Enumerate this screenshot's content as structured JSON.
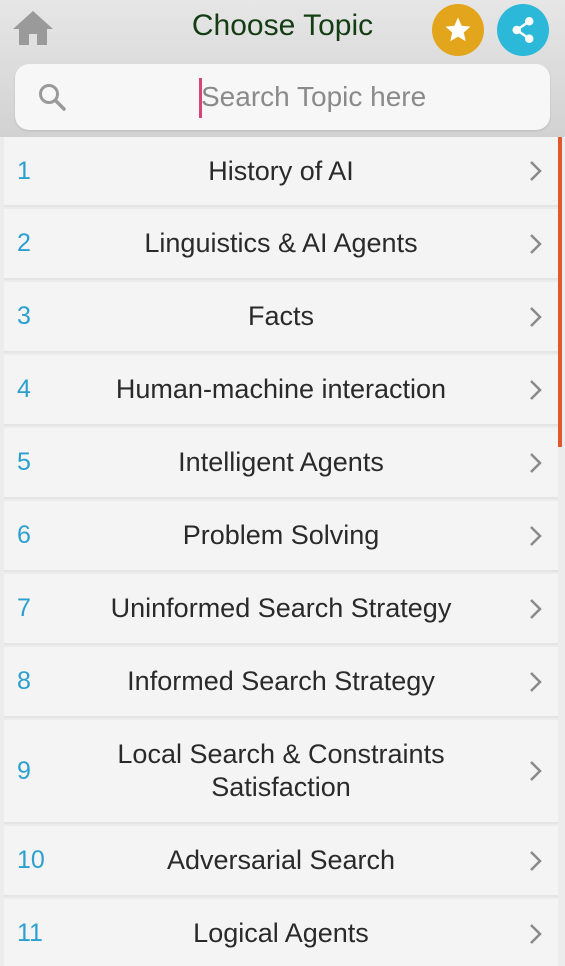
{
  "header": {
    "title": "Choose Topic",
    "home_icon": "home-icon",
    "favorite_icon": "star-icon",
    "share_icon": "share-icon",
    "favorite_color": "#e3a51b",
    "share_color": "#2cb8d8"
  },
  "search": {
    "placeholder": "Search Topic here",
    "value": ""
  },
  "topics": [
    {
      "number": "1",
      "label": "History of AI"
    },
    {
      "number": "2",
      "label": "Linguistics & AI Agents"
    },
    {
      "number": "3",
      "label": "Facts"
    },
    {
      "number": "4",
      "label": "Human-machine interaction"
    },
    {
      "number": "5",
      "label": "Intelligent Agents"
    },
    {
      "number": "6",
      "label": "Problem Solving"
    },
    {
      "number": "7",
      "label": "Uninformed Search Strategy"
    },
    {
      "number": "8",
      "label": "Informed Search Strategy"
    },
    {
      "number": "9",
      "label": "Local Search & Constraints Satisfaction"
    },
    {
      "number": "10",
      "label": "Adversarial Search"
    },
    {
      "number": "11",
      "label": "Logical Agents"
    }
  ],
  "colors": {
    "number_color": "#2ba0cf",
    "scroll_indicator": "#e2582d"
  }
}
